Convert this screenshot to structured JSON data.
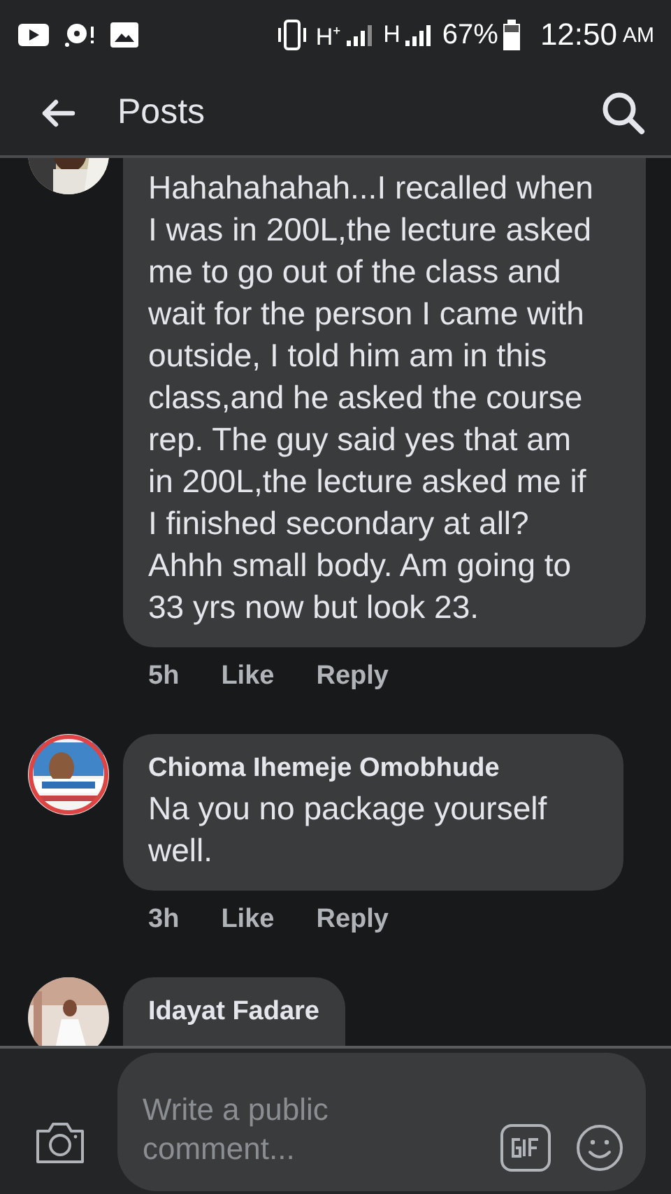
{
  "status_bar": {
    "network_1": "H⁺",
    "network_2": "H",
    "battery": "67%",
    "time": "12:50",
    "ampm": "AM"
  },
  "app_bar": {
    "title": "Posts"
  },
  "comments": [
    {
      "text": "Hahahahahah...I recalled when I was in 200L,the lecture asked me to go out of the class and wait for the person I came with outside,  I told him am in this class,and he asked the course rep. The guy said yes that am in 200L,the lecture asked me if I finished secondary at all? Ahhh small body. Am going to 33 yrs now but look 23.",
      "time": "5h",
      "like": "Like",
      "reply": "Reply"
    },
    {
      "name": "Chioma Ihemeje Omobhude",
      "text": "Na you no package  yourself well.",
      "time": "3h",
      "like": "Like",
      "reply": "Reply"
    },
    {
      "name": "Idayat Fadare"
    }
  ],
  "composer": {
    "placeholder": "Write a public comment..."
  }
}
